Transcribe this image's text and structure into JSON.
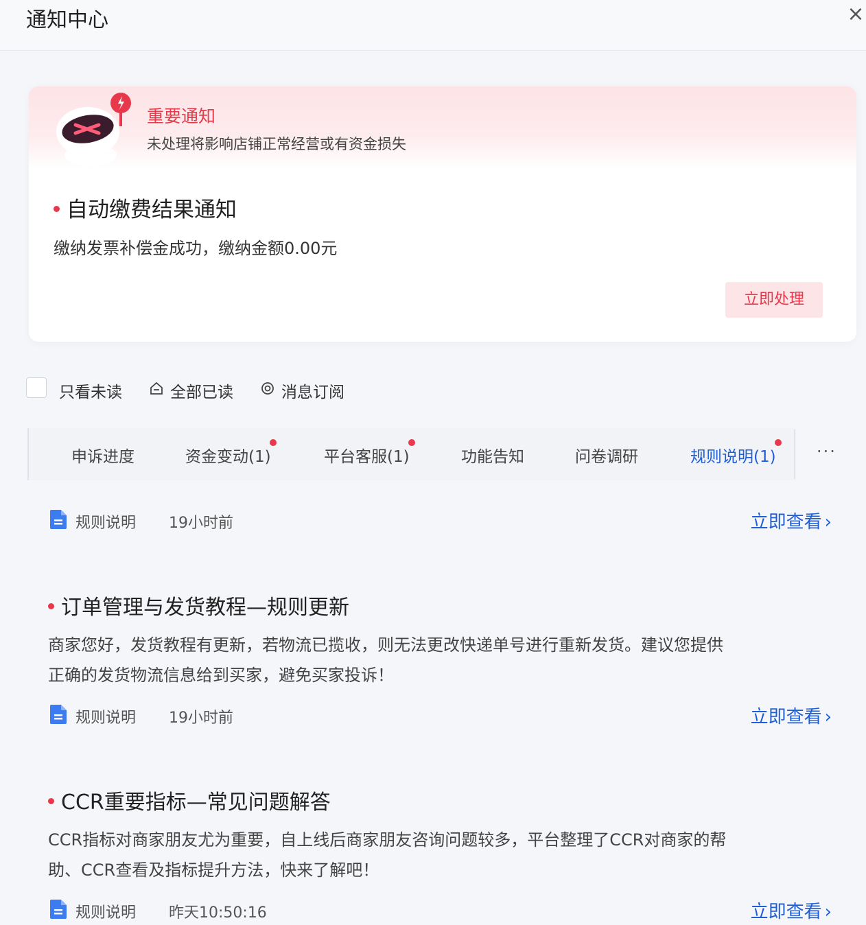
{
  "header": {
    "title": "通知中心",
    "close_icon": "×"
  },
  "important": {
    "title": "重要通知",
    "subtitle": "未处理将影响店铺正常经营或有资金损失",
    "notice_title": "自动缴费结果通知",
    "notice_desc": "缴纳发票补偿金成功，缴纳金额0.00元",
    "action_label": "立即处理"
  },
  "toolbar": {
    "unread_only_label": "只看未读",
    "mark_all_read_label": "全部已读",
    "subscribe_label": "消息订阅"
  },
  "tabs": [
    {
      "label": "申诉进度",
      "badge": false,
      "active": false
    },
    {
      "label": "资金变动(1)",
      "badge": true,
      "active": false
    },
    {
      "label": "平台客服(1)",
      "badge": true,
      "active": false
    },
    {
      "label": "功能告知",
      "badge": false,
      "active": false
    },
    {
      "label": "问卷调研",
      "badge": false,
      "active": false
    },
    {
      "label": "规则说明(1)",
      "badge": true,
      "active": true
    }
  ],
  "more_label": "···",
  "messages": [
    {
      "category": "规则说明",
      "time": "19小时前",
      "link_label": "立即查看"
    },
    {
      "title": "订单管理与发货教程—规则更新",
      "desc_line1": "商家您好，发货教程有更新，若物流已揽收，则无法更改快递单号进行重新发货。建议您提供",
      "desc_line2": "正确的发货物流信息给到买家，避免买家投诉！",
      "category": "规则说明",
      "time": "19小时前",
      "link_label": "立即查看"
    },
    {
      "title": "CCR重要指标—常见问题解答",
      "desc_line1": "CCR指标对商家朋友尤为重要，自上线后商家朋友咨询问题较多，平台整理了CCR对商家的帮",
      "desc_line2": "助、CCR查看及指标提升方法，快来了解吧！",
      "category": "规则说明",
      "time": "昨天10:50:16",
      "link_label": "立即查看"
    }
  ],
  "colors": {
    "accent": "#1f5fd6",
    "alert": "#e8384b"
  }
}
